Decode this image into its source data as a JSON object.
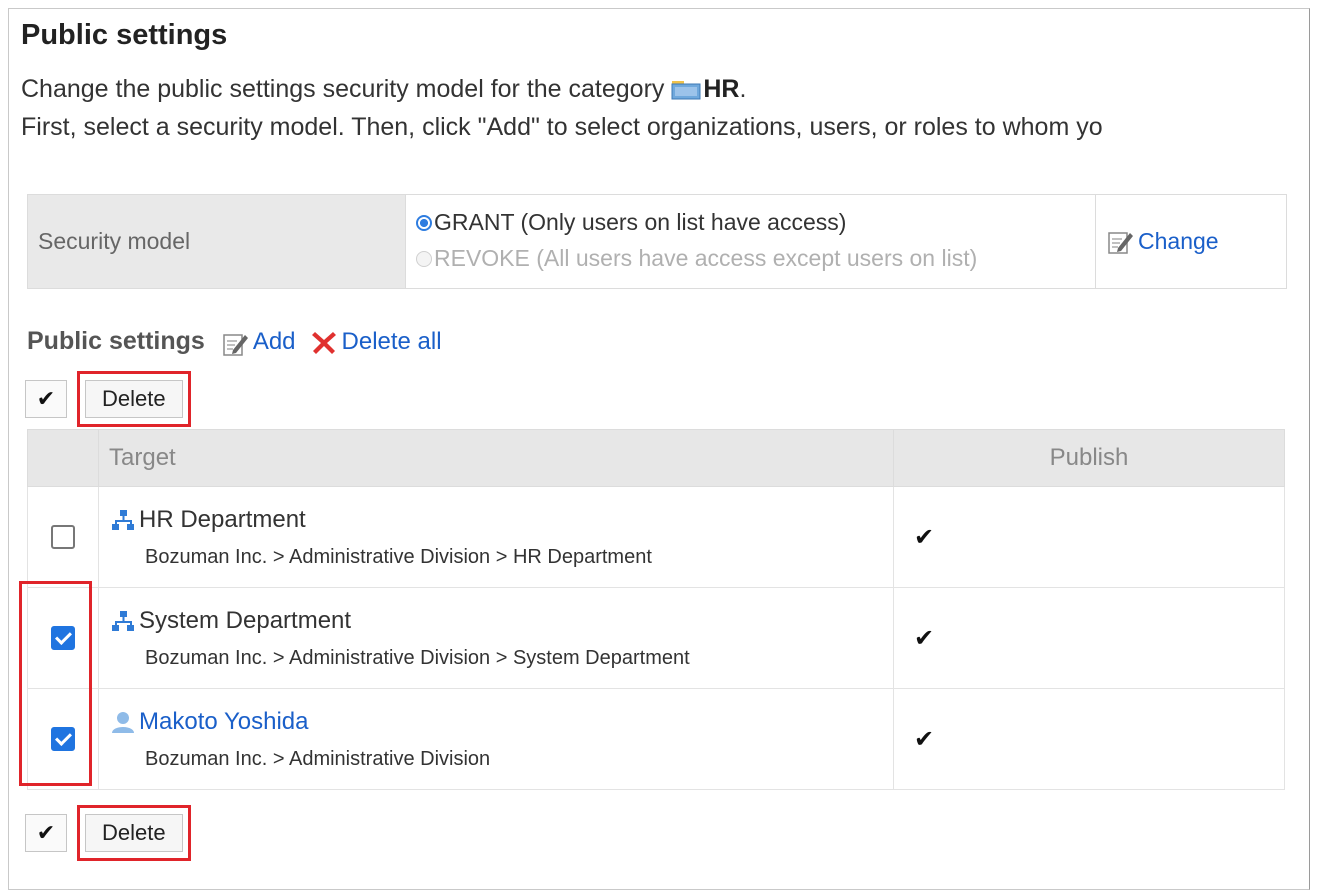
{
  "page": {
    "title": "Public settings",
    "desc_prefix": "Change the public settings security model for the category ",
    "category_name": "HR",
    "desc_suffix": ".",
    "desc_line2": "First, select a security model. Then, click \"Add\" to select organizations, users, or roles to whom yo"
  },
  "security": {
    "label": "Security model",
    "option_grant": "GRANT (Only users on list have access)",
    "option_revoke": "REVOKE (All users have access except users on list)",
    "selected": "GRANT",
    "change_label": "Change"
  },
  "public_settings": {
    "title": "Public settings",
    "add_label": "Add",
    "delete_all_label": "Delete all"
  },
  "toolbar": {
    "check_all_glyph": "✔",
    "delete_label": "Delete"
  },
  "table": {
    "col_target": "Target",
    "col_publish": "Publish",
    "rows": [
      {
        "name": "HR Department",
        "type": "organization",
        "path": "Bozuman Inc. > Administrative Division > HR Department",
        "checked": false,
        "publish": "✔"
      },
      {
        "name": "System Department",
        "type": "organization",
        "path": "Bozuman Inc. > Administrative Division > System Department",
        "checked": true,
        "publish": "✔"
      },
      {
        "name": "Makoto Yoshida",
        "type": "user",
        "path": "Bozuman Inc. > Administrative Division",
        "checked": true,
        "publish": "✔"
      }
    ]
  },
  "colors": {
    "link": "#1a5fc9",
    "highlight": "#e0242a",
    "checkbox_checked": "#1f74e0"
  }
}
